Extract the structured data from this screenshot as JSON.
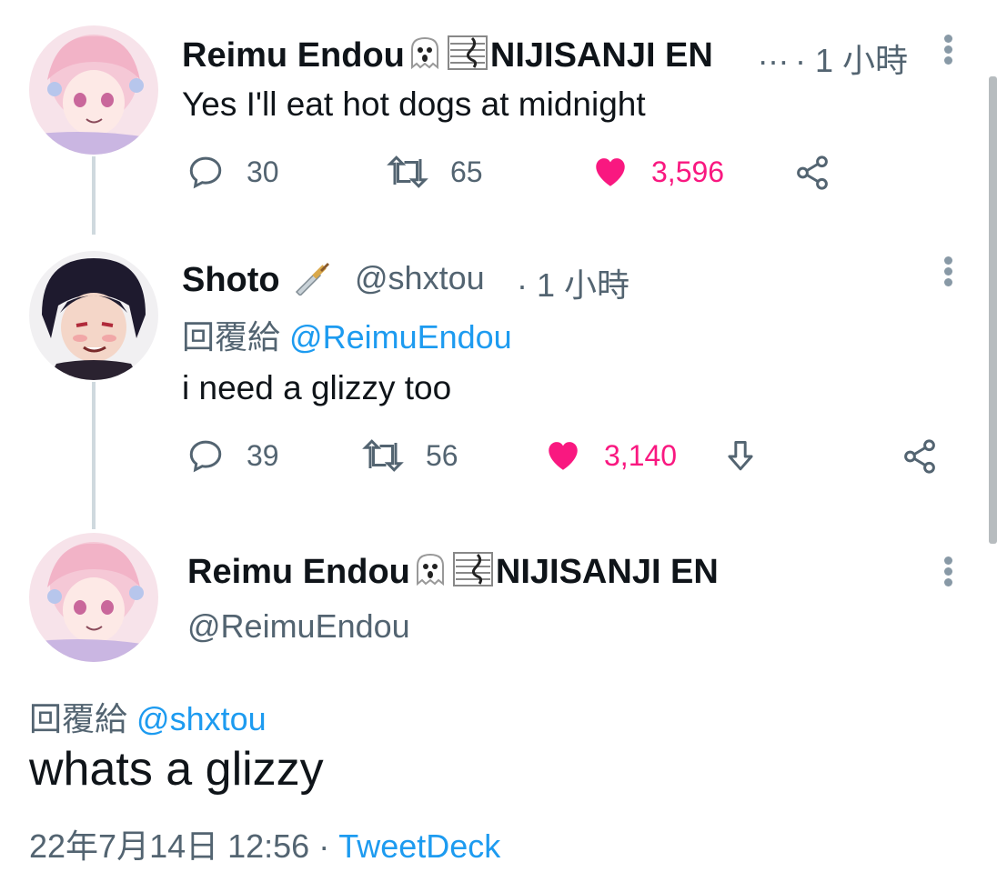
{
  "tweets": [
    {
      "author": "Reimu Endou",
      "author_suffix": "NIJISANJI EN",
      "ellipsis": "…",
      "time": "· 1 小時",
      "text": "Yes I'll eat hot dogs at midnight",
      "replies": "30",
      "retweets": "65",
      "likes": "3,596"
    },
    {
      "author": "Shoto",
      "handle": "@shxtou",
      "time": "· 1 小時",
      "reply_label": "回覆給",
      "reply_to": "@ReimuEndou",
      "text": "i need a glizzy too",
      "replies": "39",
      "retweets": "56",
      "likes": "3,140"
    }
  ],
  "main": {
    "author": "Reimu Endou",
    "author_suffix": "NIJISANJI EN",
    "handle": "@ReimuEndou",
    "reply_label": "回覆給",
    "reply_to": "@shxtou",
    "text": "whats a glizzy",
    "timestamp": "22年7月14日 12:56",
    "separator": "·",
    "source": "TweetDeck"
  },
  "colors": {
    "like": "#f91880",
    "link": "#1d9bf0",
    "muted": "#536471",
    "thread_line": "#cfd9de"
  },
  "icons": [
    "reply-icon",
    "retweet-icon",
    "heart-icon",
    "share-icon",
    "download-icon",
    "more-icon",
    "ghost-emoji",
    "music-score-emoji",
    "dagger-emoji"
  ]
}
